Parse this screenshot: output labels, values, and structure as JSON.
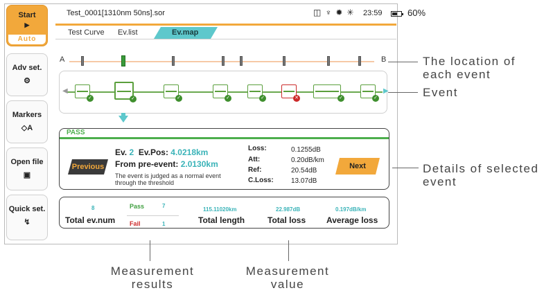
{
  "sidebar": {
    "start": {
      "label": "Start",
      "icon": "play-icon",
      "mode": "Auto"
    },
    "items": [
      {
        "label": "Adv set.",
        "icon": "gear-icon"
      },
      {
        "label": "Markers",
        "icon": "marker-diamond-icon",
        "suffix": "A"
      },
      {
        "label": "Open file",
        "icon": "folder-icon"
      },
      {
        "label": "Quick set.",
        "icon": "lightning-icon"
      }
    ]
  },
  "status": {
    "file": "Test_0001[1310nm 50ns].sor",
    "time": "23:59",
    "battery_pct": "60%",
    "battery_level": 0.6,
    "icons": [
      "lock-icon",
      "usb-icon",
      "sun-icon",
      "brightness-icon"
    ]
  },
  "tabs": [
    {
      "label": "Test Curve",
      "active": false
    },
    {
      "label": "Ev.list",
      "active": false
    },
    {
      "label": "Ev.map",
      "active": true
    }
  ],
  "event_map": {
    "start_label": "A",
    "end_label": "B"
  },
  "detail": {
    "status": "PASS",
    "ev_label": "Ev.",
    "ev_number": "2",
    "ev_pos_label": "Ev.Pos:",
    "ev_pos_value": "4.0218km",
    "from_pre_label": "From pre-event:",
    "from_pre_value": "2.0130km",
    "description": "The event is judged as a normal event through the threshold",
    "prev_label": "Previous",
    "next_label": "Next",
    "loss_label": "Loss:",
    "loss_value": "0.1255dB",
    "att_label": "Att:",
    "att_value": "0.20dB/km",
    "ref_label": "Ref:",
    "ref_value": "20.54dB",
    "closs_label": "C.Loss:",
    "closs_value": "13.07dB"
  },
  "summary": {
    "total_ev_num": "8",
    "total_ev_label": "Total ev.num",
    "pass_label": "Pass",
    "pass_count": "7",
    "fail_label": "Fail",
    "fail_count": "1",
    "total_length": "115.11020km",
    "total_length_label": "Total length",
    "total_loss": "22.987dB",
    "total_loss_label": "Total loss",
    "avg_loss": "0.197dB/km",
    "avg_loss_label": "Average loss"
  },
  "annotations": {
    "location": "The location of each event",
    "event": "Event",
    "details": "Details of selected event",
    "results": "Measurement results",
    "value": "Measurement value"
  }
}
